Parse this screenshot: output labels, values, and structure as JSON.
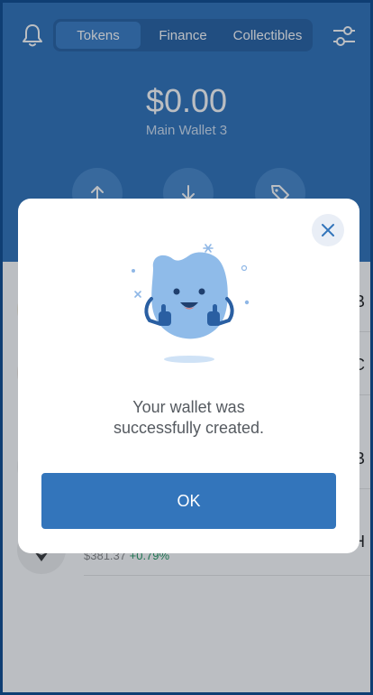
{
  "header": {
    "tabs": [
      {
        "label": "Tokens",
        "active": true
      },
      {
        "label": "Finance",
        "active": false
      },
      {
        "label": "Collectibles",
        "active": false
      }
    ],
    "balance": "$0.00",
    "wallet_name": "Main Wallet 3"
  },
  "token_list": {
    "rows": [
      {
        "trailing": "B"
      },
      {
        "trailing": "C"
      },
      {
        "trailing": "B"
      },
      {
        "trailing": "H",
        "price": "$381.37",
        "change": "+0.79%"
      }
    ]
  },
  "modal": {
    "message_line1": "Your wallet was",
    "message_line2": "successfully created.",
    "ok_label": "OK"
  },
  "colors": {
    "brand_blue": "#3375bb",
    "positive_green": "#2b9a66"
  },
  "icons": [
    "bell-icon",
    "filters-icon",
    "send-arrow-icon",
    "receive-arrow-icon",
    "tag-icon",
    "close-icon",
    "ethereum-icon"
  ]
}
